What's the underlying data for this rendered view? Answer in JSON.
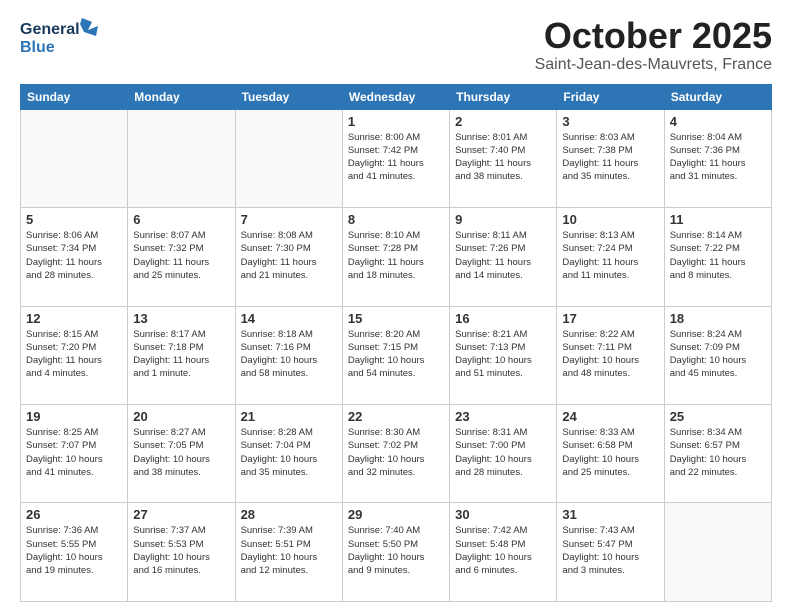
{
  "header": {
    "logo_line1": "General",
    "logo_line2": "Blue",
    "month": "October 2025",
    "location": "Saint-Jean-des-Mauvrets, France"
  },
  "weekdays": [
    "Sunday",
    "Monday",
    "Tuesday",
    "Wednesday",
    "Thursday",
    "Friday",
    "Saturday"
  ],
  "weeks": [
    [
      {
        "day": "",
        "info": ""
      },
      {
        "day": "",
        "info": ""
      },
      {
        "day": "",
        "info": ""
      },
      {
        "day": "1",
        "info": "Sunrise: 8:00 AM\nSunset: 7:42 PM\nDaylight: 11 hours\nand 41 minutes."
      },
      {
        "day": "2",
        "info": "Sunrise: 8:01 AM\nSunset: 7:40 PM\nDaylight: 11 hours\nand 38 minutes."
      },
      {
        "day": "3",
        "info": "Sunrise: 8:03 AM\nSunset: 7:38 PM\nDaylight: 11 hours\nand 35 minutes."
      },
      {
        "day": "4",
        "info": "Sunrise: 8:04 AM\nSunset: 7:36 PM\nDaylight: 11 hours\nand 31 minutes."
      }
    ],
    [
      {
        "day": "5",
        "info": "Sunrise: 8:06 AM\nSunset: 7:34 PM\nDaylight: 11 hours\nand 28 minutes."
      },
      {
        "day": "6",
        "info": "Sunrise: 8:07 AM\nSunset: 7:32 PM\nDaylight: 11 hours\nand 25 minutes."
      },
      {
        "day": "7",
        "info": "Sunrise: 8:08 AM\nSunset: 7:30 PM\nDaylight: 11 hours\nand 21 minutes."
      },
      {
        "day": "8",
        "info": "Sunrise: 8:10 AM\nSunset: 7:28 PM\nDaylight: 11 hours\nand 18 minutes."
      },
      {
        "day": "9",
        "info": "Sunrise: 8:11 AM\nSunset: 7:26 PM\nDaylight: 11 hours\nand 14 minutes."
      },
      {
        "day": "10",
        "info": "Sunrise: 8:13 AM\nSunset: 7:24 PM\nDaylight: 11 hours\nand 11 minutes."
      },
      {
        "day": "11",
        "info": "Sunrise: 8:14 AM\nSunset: 7:22 PM\nDaylight: 11 hours\nand 8 minutes."
      }
    ],
    [
      {
        "day": "12",
        "info": "Sunrise: 8:15 AM\nSunset: 7:20 PM\nDaylight: 11 hours\nand 4 minutes."
      },
      {
        "day": "13",
        "info": "Sunrise: 8:17 AM\nSunset: 7:18 PM\nDaylight: 11 hours\nand 1 minute."
      },
      {
        "day": "14",
        "info": "Sunrise: 8:18 AM\nSunset: 7:16 PM\nDaylight: 10 hours\nand 58 minutes."
      },
      {
        "day": "15",
        "info": "Sunrise: 8:20 AM\nSunset: 7:15 PM\nDaylight: 10 hours\nand 54 minutes."
      },
      {
        "day": "16",
        "info": "Sunrise: 8:21 AM\nSunset: 7:13 PM\nDaylight: 10 hours\nand 51 minutes."
      },
      {
        "day": "17",
        "info": "Sunrise: 8:22 AM\nSunset: 7:11 PM\nDaylight: 10 hours\nand 48 minutes."
      },
      {
        "day": "18",
        "info": "Sunrise: 8:24 AM\nSunset: 7:09 PM\nDaylight: 10 hours\nand 45 minutes."
      }
    ],
    [
      {
        "day": "19",
        "info": "Sunrise: 8:25 AM\nSunset: 7:07 PM\nDaylight: 10 hours\nand 41 minutes."
      },
      {
        "day": "20",
        "info": "Sunrise: 8:27 AM\nSunset: 7:05 PM\nDaylight: 10 hours\nand 38 minutes."
      },
      {
        "day": "21",
        "info": "Sunrise: 8:28 AM\nSunset: 7:04 PM\nDaylight: 10 hours\nand 35 minutes."
      },
      {
        "day": "22",
        "info": "Sunrise: 8:30 AM\nSunset: 7:02 PM\nDaylight: 10 hours\nand 32 minutes."
      },
      {
        "day": "23",
        "info": "Sunrise: 8:31 AM\nSunset: 7:00 PM\nDaylight: 10 hours\nand 28 minutes."
      },
      {
        "day": "24",
        "info": "Sunrise: 8:33 AM\nSunset: 6:58 PM\nDaylight: 10 hours\nand 25 minutes."
      },
      {
        "day": "25",
        "info": "Sunrise: 8:34 AM\nSunset: 6:57 PM\nDaylight: 10 hours\nand 22 minutes."
      }
    ],
    [
      {
        "day": "26",
        "info": "Sunrise: 7:36 AM\nSunset: 5:55 PM\nDaylight: 10 hours\nand 19 minutes."
      },
      {
        "day": "27",
        "info": "Sunrise: 7:37 AM\nSunset: 5:53 PM\nDaylight: 10 hours\nand 16 minutes."
      },
      {
        "day": "28",
        "info": "Sunrise: 7:39 AM\nSunset: 5:51 PM\nDaylight: 10 hours\nand 12 minutes."
      },
      {
        "day": "29",
        "info": "Sunrise: 7:40 AM\nSunset: 5:50 PM\nDaylight: 10 hours\nand 9 minutes."
      },
      {
        "day": "30",
        "info": "Sunrise: 7:42 AM\nSunset: 5:48 PM\nDaylight: 10 hours\nand 6 minutes."
      },
      {
        "day": "31",
        "info": "Sunrise: 7:43 AM\nSunset: 5:47 PM\nDaylight: 10 hours\nand 3 minutes."
      },
      {
        "day": "",
        "info": ""
      }
    ]
  ]
}
